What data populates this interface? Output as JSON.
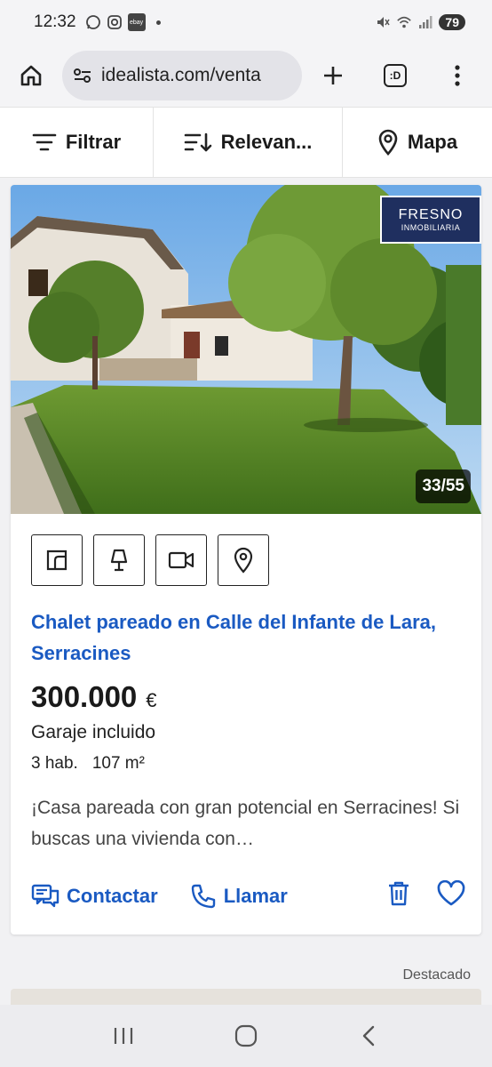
{
  "status_bar": {
    "time": "12:32",
    "ebay_label": "ebay",
    "battery": "79"
  },
  "browser": {
    "url": "idealista.com/venta",
    "tab_icon_label": ":D"
  },
  "filters": {
    "filter_label": "Filtrar",
    "sort_label": "Relevan...",
    "map_label": "Mapa"
  },
  "listing": {
    "agency_line1": "FRESNO",
    "agency_line2": "INMOBILIARIA",
    "photo_counter": "33/55",
    "feature_icons": [
      "floorplan-icon",
      "lamp-icon",
      "video-icon",
      "location-pin-icon"
    ],
    "title": "Chalet pareado en Calle del Infante de Lara, Serracines",
    "price": "300.000",
    "currency": "€",
    "extra": "Garaje incluido",
    "rooms": "3 hab.",
    "area": "107 m²",
    "description": "¡Casa pareada con gran potencial en Serracines! Si buscas una vivienda con…",
    "contact_label": "Contactar",
    "call_label": "Llamar"
  },
  "next_listing": {
    "badge": "Destacado"
  },
  "colors": {
    "link_blue": "#1a5ac2",
    "agency_navy": "#1f2f5f"
  }
}
